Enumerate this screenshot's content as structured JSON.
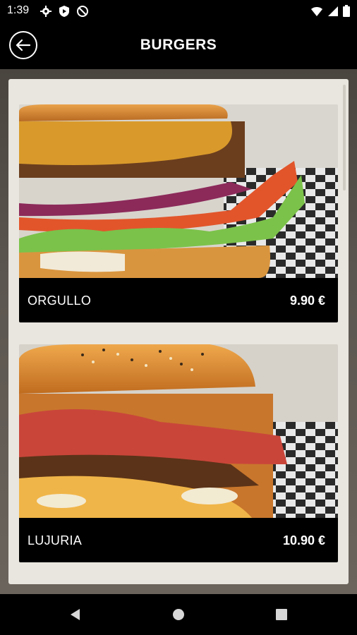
{
  "status": {
    "time": "1:39",
    "left_icons": [
      "gear-icon",
      "play-protect-icon",
      "no-sync-icon"
    ],
    "right_icons": [
      "wifi-icon",
      "signal-icon",
      "battery-icon"
    ]
  },
  "header": {
    "title": "BURGERS",
    "back_icon": "back-arrow-icon"
  },
  "products": [
    {
      "name": "ORGULLO",
      "price": "9.90 €"
    },
    {
      "name": "LUJURIA",
      "price": "10.90 €"
    }
  ],
  "nav": {
    "icons": [
      "back-triangle-icon",
      "home-circle-icon",
      "recents-square-icon"
    ]
  },
  "colors": {
    "bar": "#000000",
    "panel": "#e9e6df",
    "text_light": "#ffffff"
  }
}
